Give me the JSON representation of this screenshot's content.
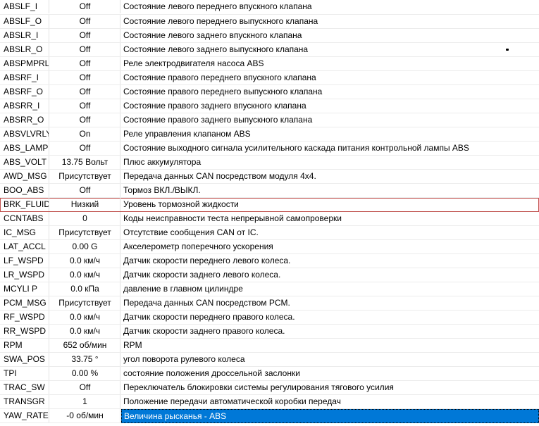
{
  "rows": [
    {
      "name": "ABSLF_I",
      "value": "Off",
      "description": "Состояние левого переднего впускного клапана"
    },
    {
      "name": "ABSLF_O",
      "value": "Off",
      "description": "Состояние левого переднего выпускного клапана"
    },
    {
      "name": "ABSLR_I",
      "value": "Off",
      "description": "Состояние левого заднего впускного клапана"
    },
    {
      "name": "ABSLR_O",
      "value": "Off",
      "description": "Состояние левого заднего выпускного клапана"
    },
    {
      "name": "ABSPMPRLY",
      "value": "Off",
      "description": "Реле электродвигателя насоса ABS"
    },
    {
      "name": "ABSRF_I",
      "value": "Off",
      "description": "Состояние правого переднего впускного клапана"
    },
    {
      "name": "ABSRF_O",
      "value": "Off",
      "description": "Состояние правого переднего выпускного клапана"
    },
    {
      "name": "ABSRR_I",
      "value": "Off",
      "description": "Состояние правого заднего впускного клапана"
    },
    {
      "name": "ABSRR_O",
      "value": "Off",
      "description": "Состояние правого заднего выпускного клапана"
    },
    {
      "name": "ABSVLVRLY",
      "value": "On",
      "description": "Реле управления клапаном ABS"
    },
    {
      "name": "ABS_LAMP",
      "value": "Off",
      "description": "Состояние выходного сигнала усилительного каскада питания контрольной лампы ABS"
    },
    {
      "name": "ABS_VOLT",
      "value": "13.75 Вольт",
      "description": "Плюс аккумулятора"
    },
    {
      "name": "AWD_MSG",
      "value": "Присутствует",
      "description": "Передача данных CAN посредством модуля 4x4."
    },
    {
      "name": "BOO_ABS",
      "value": "Off",
      "description": "Тормоз ВКЛ./ВЫКЛ."
    },
    {
      "name": "BRK_FLUID",
      "value": "Низкий",
      "description": "Уровень тормозной жидкости"
    },
    {
      "name": "CCNTABS",
      "value": "0",
      "description": "Коды неисправности теста непрерывной самопроверки"
    },
    {
      "name": "IC_MSG",
      "value": "Присутствует",
      "description": "Отсутствие сообщения CAN от IC."
    },
    {
      "name": "LAT_ACCL",
      "value": "0.00 G",
      "description": "Акселерометр поперечного ускорения"
    },
    {
      "name": "LF_WSPD",
      "value": "0.0 км/ч",
      "description": "Датчик скорости переднего левого колеса."
    },
    {
      "name": "LR_WSPD",
      "value": "0.0 км/ч",
      "description": "Датчик скорости заднего левого колеса."
    },
    {
      "name": "MCYLI P",
      "value": "0.0 кПа",
      "description": "давление в главном цилиндре"
    },
    {
      "name": "PCM_MSG",
      "value": "Присутствует",
      "description": "Передача данных CAN посредством PCM."
    },
    {
      "name": "RF_WSPD",
      "value": "0.0 км/ч",
      "description": "Датчик скорости переднего правого колеса."
    },
    {
      "name": "RR_WSPD",
      "value": "0.0 км/ч",
      "description": "Датчик скорости заднего правого колеса."
    },
    {
      "name": "RPM",
      "value": "652 об/мин",
      "description": "RPM"
    },
    {
      "name": "SWA_POS",
      "value": "33.75 °",
      "description": "угол поворота рулевого колеса"
    },
    {
      "name": "TPI",
      "value": "0.00 %",
      "description": "состояние положения дроссельной заслонки"
    },
    {
      "name": "TRAC_SW",
      "value": "Off",
      "description": "Переключатель блокировки системы регулирования тягового усилия"
    },
    {
      "name": "TRANSGR",
      "value": "1",
      "description": "Положение передачи автоматической коробки передач"
    },
    {
      "name": "YAW_RATE",
      "value": "-0 об/мин",
      "description": "Величина рысканья - ABS"
    }
  ],
  "outlined_row": "BRK_FLUID",
  "selected_row": "YAW_RATE",
  "colors": {
    "selection": "#0078d7",
    "outline": "#c0504d",
    "grid_line": "#ececec"
  }
}
